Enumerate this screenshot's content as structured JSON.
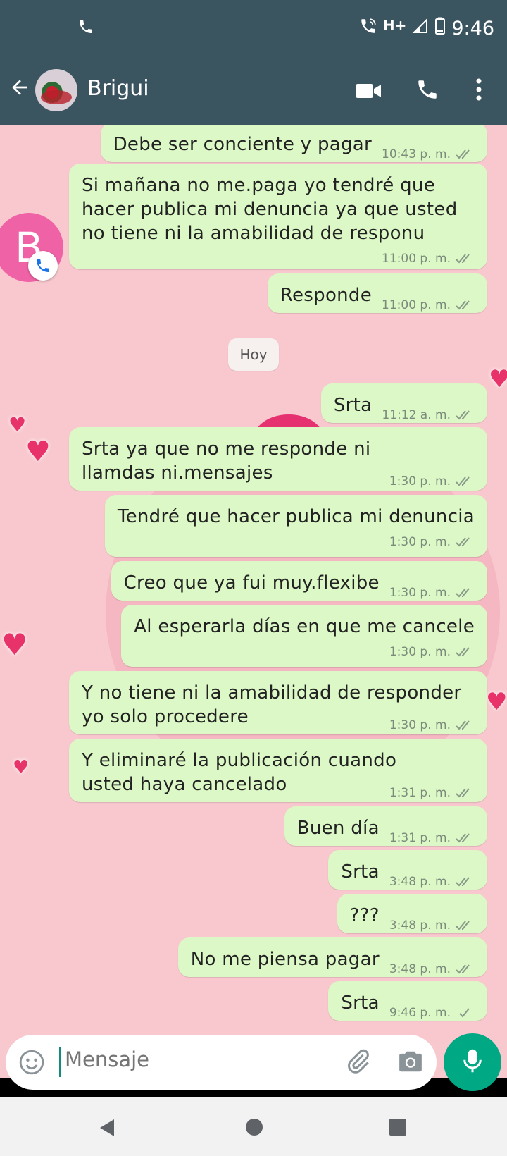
{
  "status_bar": {
    "time": "9:46",
    "network": "H+"
  },
  "contact": {
    "name": "Brigui"
  },
  "chathead": {
    "initial": "B"
  },
  "date_chip": "Hoy",
  "messages": [
    {
      "text": "Debe ser conciente y pagar",
      "time": "10:43 p. m.",
      "status": "read"
    },
    {
      "text": "Si mañana no me.paga yo tendré que hacer publica mi denuncia ya que usted no tiene ni la amabilidad de responu",
      "time": "11:00 p. m.",
      "status": "read"
    },
    {
      "text": "Responde",
      "time": "11:00 p. m.",
      "status": "read"
    },
    {
      "text": "Srta",
      "time": "11:12 a. m.",
      "status": "read"
    },
    {
      "text": "Srta ya que no me responde ni llamdas ni.mensajes",
      "time": "1:30 p. m.",
      "status": "read"
    },
    {
      "text": "Tendré que hacer publica mi denuncia",
      "time": "1:30 p. m.",
      "status": "read"
    },
    {
      "text": "Creo que ya fui muy.flexibe",
      "time": "1:30 p. m.",
      "status": "read"
    },
    {
      "text": "Al esperarla días en que me cancele",
      "time": "1:30 p. m.",
      "status": "read"
    },
    {
      "text": "Y no tiene ni la amabilidad de responder yo solo procedere",
      "time": "1:30 p. m.",
      "status": "read"
    },
    {
      "text": "Y eliminaré la publicación cuando usted haya cancelado",
      "time": "1:31 p. m.",
      "status": "read"
    },
    {
      "text": "Buen día",
      "time": "1:31 p. m.",
      "status": "read"
    },
    {
      "text": "Srta",
      "time": "3:48 p. m.",
      "status": "read"
    },
    {
      "text": "???",
      "time": "3:48 p. m.",
      "status": "read"
    },
    {
      "text": "No me piensa pagar",
      "time": "3:48 p. m.",
      "status": "read"
    },
    {
      "text": "Srta",
      "time": "9:46 p. m.",
      "status": "sent"
    }
  ],
  "composer": {
    "placeholder": "Mensaje"
  },
  "icons": {
    "status_call": "phone-icon",
    "wifi_call": "wifi-call-icon",
    "signal": "signal-icon",
    "battery": "battery-icon",
    "back": "arrow-left-icon",
    "video": "video-camera-icon",
    "voice": "phone-icon",
    "menu": "more-vertical-icon",
    "emoji": "smiley-icon",
    "attach": "paperclip-icon",
    "camera": "camera-icon",
    "mic": "microphone-icon",
    "nav_back": "triangle-back-icon",
    "nav_home": "circle-home-icon",
    "nav_recents": "square-recents-icon"
  },
  "colors": {
    "header": "#3b5560",
    "outgoing_bubble": "#dcf8c6",
    "accent": "#00a884",
    "chathead": "#f062a6",
    "wallpaper": "#f8c8ce"
  }
}
